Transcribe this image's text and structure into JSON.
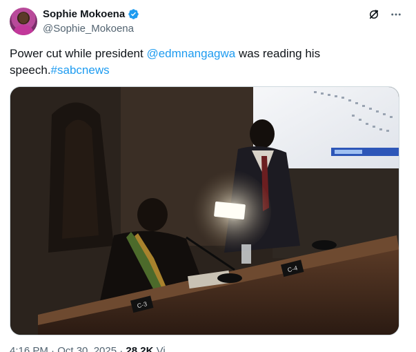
{
  "author": {
    "display_name": "Sophie Mokoena",
    "handle": "@Sophie_Mokoena",
    "verified": true
  },
  "tweet": {
    "text_before": "Power cut while president ",
    "mention": "@edmnangagwa",
    "text_middle": " was reading his speech.",
    "hashtag": "#sabcnews"
  },
  "meta": {
    "time_date": "4:16 PM · Oct 30, 2025 · ",
    "views_count": "28.2K",
    "views_label": " Vi"
  },
  "media": {
    "placard_left": "C-3",
    "placard_right": "C-4"
  },
  "icons": {
    "verified": "verified-badge-icon",
    "grok": "grok-icon",
    "more": "more-icon"
  },
  "colors": {
    "accent": "#1d9bf0",
    "text": "#0f1419",
    "secondary": "#536471"
  }
}
